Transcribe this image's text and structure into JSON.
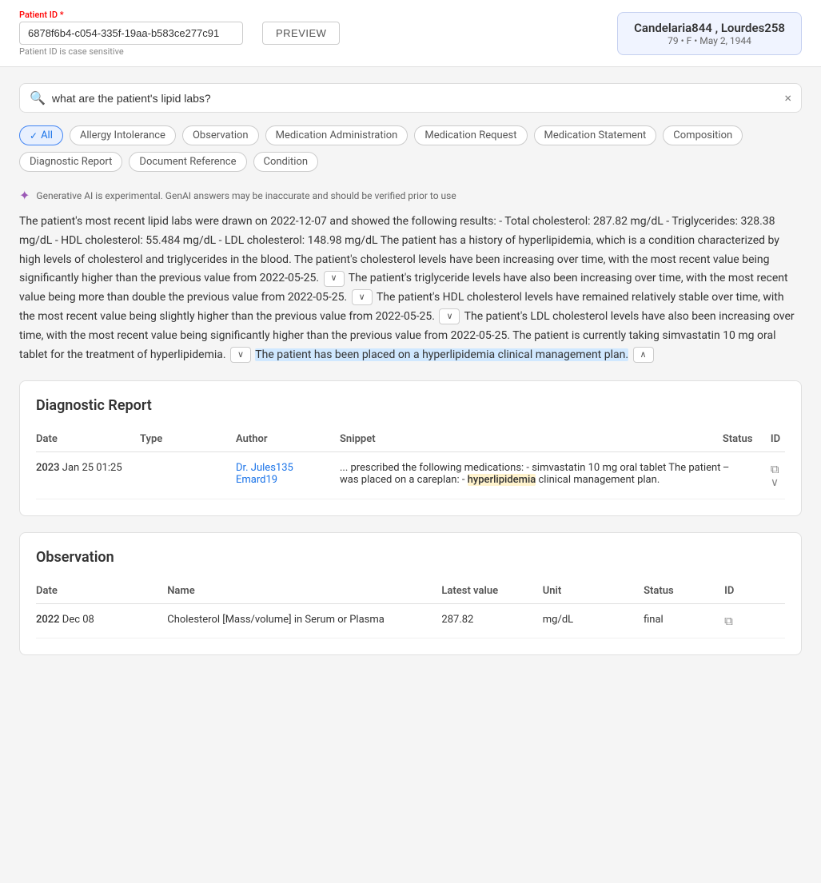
{
  "topbar": {
    "patient_id_label": "Patient ID",
    "patient_id_required": "*",
    "patient_id_value": "6878f6b4-c054-335f-19aa-b583ce277c91",
    "patient_id_hint": "Patient ID is case sensitive",
    "preview_label": "PREVIEW",
    "patient_name": "Candelaria844 , Lourdes258",
    "patient_details": "79 • F • May 2, 1944"
  },
  "search": {
    "placeholder": "what are the patient's lipid labs?",
    "value": "what are the patient's lipid labs?",
    "clear_icon": "×"
  },
  "filters": [
    {
      "label": "All",
      "active": true
    },
    {
      "label": "Allergy Intolerance",
      "active": false
    },
    {
      "label": "Observation",
      "active": false
    },
    {
      "label": "Medication Administration",
      "active": false
    },
    {
      "label": "Medication Request",
      "active": false
    },
    {
      "label": "Medication Statement",
      "active": false
    },
    {
      "label": "Composition",
      "active": false
    },
    {
      "label": "Diagnostic Report",
      "active": false
    },
    {
      "label": "Document Reference",
      "active": false
    },
    {
      "label": "Condition",
      "active": false
    }
  ],
  "ai_notice": "Generative AI is experimental. GenAI answers may be inaccurate and should be verified prior to use",
  "ai_answer": {
    "part1": "The patient's most recent lipid labs were drawn on 2022-12-07 and showed the following results: - Total cholesterol: 287.82 mg/dL - Triglycerides: 328.38 mg/dL - HDL cholesterol: 55.484 mg/dL - LDL cholesterol: 148.98 mg/dL The patient has a history of hyperlipidemia, which is a condition characterized by high levels of cholesterol and triglycerides in the blood. The patient's cholesterol levels have been increasing over time, with the most recent value being significantly higher than the previous value from 2022-05-25.",
    "part2": "The patient's triglyceride levels have also been increasing over time, with the most recent value being more than double the previous value from 2022-05-25.",
    "part3": "The patient's HDL cholesterol levels have remained relatively stable over time, with the most recent value being slightly higher than the previous value from 2022-05-25.",
    "part4": "The patient's LDL cholesterol levels have also been increasing over time, with the most recent value being significantly higher than the previous value from 2022-05-25. The patient is currently taking simvastatin 10 mg oral tablet for the treatment of hyperlipidemia.",
    "part5_highlight": "The patient has been placed on a hyperlipidemia clinical management plan."
  },
  "diagnostic_report": {
    "title": "Diagnostic Report",
    "columns": [
      "Date",
      "Type",
      "Author",
      "Snippet",
      "Status",
      "ID"
    ],
    "rows": [
      {
        "date_year": "2023",
        "date_rest": "Jan  25  01:25",
        "type": "",
        "author_line1": "Dr. Jules135",
        "author_line2": "Emard19",
        "snippet": "... prescribed the following medications: - simvastatin 10 mg oral tablet The patient was placed on a careplan: - ",
        "snippet_highlight": "hyperlipidemia",
        "snippet_end": " clinical management plan.",
        "status": "–",
        "id": ""
      }
    ]
  },
  "observation": {
    "title": "Observation",
    "columns": [
      "Date",
      "Name",
      "Latest value",
      "Unit",
      "Status",
      "ID"
    ],
    "rows": [
      {
        "date_year": "2022",
        "date_rest": "Dec  08",
        "name": "Cholesterol [Mass/volume] in Serum or Plasma",
        "latest_value": "287.82",
        "unit": "mg/dL",
        "status": "final",
        "id": ""
      }
    ]
  }
}
